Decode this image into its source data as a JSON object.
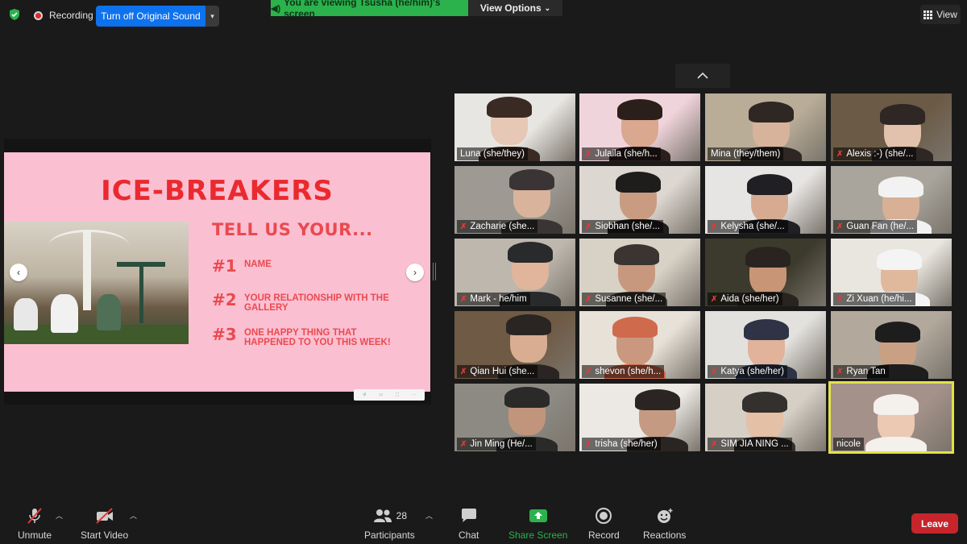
{
  "top_bar": {
    "recording_label": "Recording",
    "original_sound_button": "Turn off Original Sound",
    "viewing_banner": "You are viewing Tsusha (he/him)'s screen",
    "view_options_label": "View Options",
    "view_label": "View",
    "security_color": "#2bb24c",
    "banner_color": "#2bb24c"
  },
  "shared_slide": {
    "title": "ICE-BREAKERS",
    "subtitle": "TELL US YOUR...",
    "items": [
      {
        "number": "#1",
        "text": "NAME"
      },
      {
        "number": "#2",
        "text": "YOUR RELATIONSHIP WITH THE GALLERY"
      },
      {
        "number": "#3",
        "text": "ONE HAPPY THING THAT HAPPENED TO YOU THIS WEEK!"
      }
    ],
    "prev_arrow": "‹",
    "next_arrow": "›",
    "background_color": "#fbbfd2",
    "accent_color": "#ea2a2e"
  },
  "gallery": {
    "participants": [
      {
        "name": "Luna (she/they)",
        "muted": false
      },
      {
        "name": "Julaila (she/h...",
        "muted": true
      },
      {
        "name": "Mina (they/them)",
        "muted": false
      },
      {
        "name": "Alexis :-) (she/...",
        "muted": true
      },
      {
        "name": "Zacharie (she...",
        "muted": true
      },
      {
        "name": "Siobhan (she/...",
        "muted": true
      },
      {
        "name": "Kelysha (she/...",
        "muted": true
      },
      {
        "name": "Guan Fan (he/...",
        "muted": true
      },
      {
        "name": "Mark - he/him",
        "muted": true
      },
      {
        "name": "Susanne (she/...",
        "muted": true
      },
      {
        "name": "Aida (she/her)",
        "muted": true
      },
      {
        "name": "Zi Xuan (he/hi...",
        "muted": true
      },
      {
        "name": "Qian Hui (she...",
        "muted": true
      },
      {
        "name": "shevon (she/h...",
        "muted": true
      },
      {
        "name": "Katya (she/her)",
        "muted": true
      },
      {
        "name": "Ryan Tan",
        "muted": true
      },
      {
        "name": "Jin Ming (He/...",
        "muted": true
      },
      {
        "name": "trisha (she/her)",
        "muted": true
      },
      {
        "name": "SIM JIA NING ...",
        "muted": true
      },
      {
        "name": "nicole",
        "muted": false
      }
    ],
    "active_speaker_color": "#e2e24a"
  },
  "toolbar": {
    "unmute_label": "Unmute",
    "start_video_label": "Start Video",
    "participants_label": "Participants",
    "participants_count": "28",
    "chat_label": "Chat",
    "share_screen_label": "Share Screen",
    "record_label": "Record",
    "reactions_label": "Reactions",
    "leave_label": "Leave",
    "leave_color": "#c6252b"
  }
}
